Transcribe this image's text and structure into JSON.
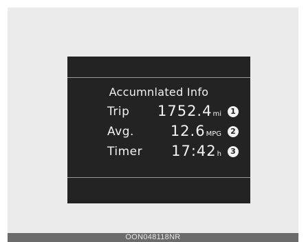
{
  "display": {
    "title": "Accumnlated Info",
    "rows": [
      {
        "label": "Trip",
        "value": "1752.4",
        "unit": "mi",
        "callout": "1"
      },
      {
        "label": "Avg.",
        "value": "12.6",
        "unit": "MPG",
        "callout": "2"
      },
      {
        "label": "Timer",
        "value": "17:42",
        "unit": "h",
        "callout": "3"
      }
    ]
  },
  "caption": "OON048118NR"
}
